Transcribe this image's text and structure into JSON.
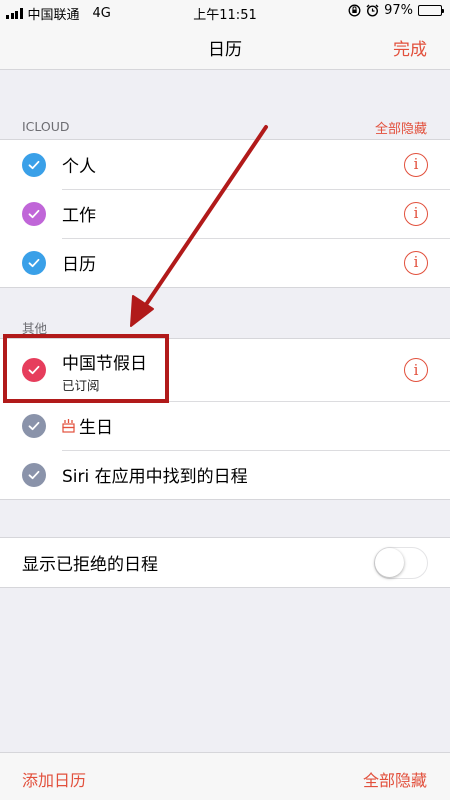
{
  "status_bar": {
    "carrier": "中国联通",
    "network": "4G",
    "time": "上午11:51",
    "battery_percent": "97%",
    "battery_level": 0.97
  },
  "nav": {
    "title": "日历",
    "done_label": "完成"
  },
  "icloud_section": {
    "header": "ICLOUD",
    "hide_all_label": "全部隐藏",
    "items": [
      {
        "label": "个人",
        "color": "#3aa0e8",
        "icon": "checkmark-icon"
      },
      {
        "label": "工作",
        "color": "#c066d8",
        "icon": "checkmark-icon"
      },
      {
        "label": "日历",
        "color": "#3aa0e8",
        "icon": "checkmark-icon"
      }
    ]
  },
  "other_section": {
    "header": "其他",
    "items": [
      {
        "label": "中国节假日",
        "sublabel": "已订阅",
        "color": "#e63d5c",
        "icon": "checkmark-icon"
      },
      {
        "label": "生日",
        "color": "#8a93aa",
        "icon": "birthday-cake-icon"
      },
      {
        "label": "Siri 在应用中找到的日程",
        "color": "#8a93aa",
        "icon": "checkmark-icon"
      }
    ]
  },
  "declined_setting": {
    "label": "显示已拒绝的日程",
    "toggle_on": false
  },
  "toolbar": {
    "add_calendar_label": "添加日历",
    "hide_all_label": "全部隐藏"
  },
  "colors": {
    "accent": "#e2503c",
    "annotation": "#b11a1a"
  }
}
